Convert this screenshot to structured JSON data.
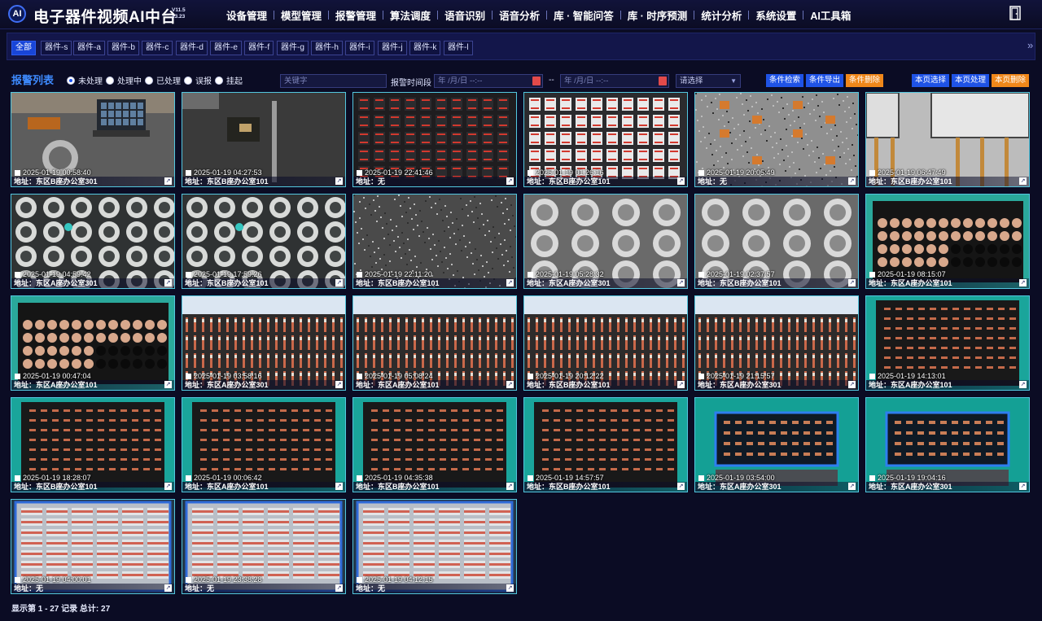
{
  "header": {
    "logo": "AI",
    "title": "电子器件视频AI中台",
    "version_top": "V11.5",
    "version_bottom": "x3.23",
    "nav": [
      "设备管理",
      "模型管理",
      "报警管理",
      "算法调度",
      "语音识别",
      "语音分析",
      "库 · 智能问答",
      "库 · 时序预测",
      "统计分析",
      "系统设置",
      "AI工具箱"
    ]
  },
  "filters": {
    "chips": [
      "全部",
      "器件-s",
      "器件-a",
      "器件-b",
      "器件-c",
      "器件-d",
      "器件-e",
      "器件-f",
      "器件-g",
      "器件-h",
      "器件-i",
      "器件-j",
      "器件-k",
      "器件-l"
    ],
    "active": "全部",
    "expand_icon": "chevron-double-right-icon"
  },
  "toolbar": {
    "title": "报警列表",
    "status_options": [
      "未处理",
      "处理中",
      "已处理",
      "误报",
      "挂起"
    ],
    "selected_status": "未处理",
    "keyword_placeholder": "关键字",
    "time_label": "报警时间段",
    "date_start_placeholder": "年 /月/日 --:--",
    "date_sep": "--",
    "date_end_placeholder": "年 /月/日 --:--",
    "select_placeholder": "请选择",
    "buttons_left": [
      "条件检索",
      "条件导出",
      "条件删除"
    ],
    "buttons_right": [
      "本页选择",
      "本页处理",
      "本页删除"
    ]
  },
  "alarms": [
    {
      "time": "2025-01-19 00:58:40",
      "addr": "地址：东区B座办公室301",
      "scene": "desk"
    },
    {
      "time": "2025-01-19 04:27:53",
      "addr": "地址：东区B座办公室101",
      "scene": "table"
    },
    {
      "time": "2025-01-19 22:41:46",
      "addr": "地址：无",
      "scene": "chips-dark"
    },
    {
      "time": "2025-01-19 01:26:16",
      "addr": "地址：东区B座办公室101",
      "scene": "chips-grid"
    },
    {
      "time": "2025-01-19 20:05:49",
      "addr": "地址：无",
      "scene": "granite"
    },
    {
      "time": "2025-01-19 06:47:49",
      "addr": "地址：东区B座办公室101",
      "scene": "component"
    },
    {
      "time": "2025-01-19 04:59:42",
      "addr": "地址：东区A座办公室301",
      "scene": "discs"
    },
    {
      "time": "2025-01-19 17:59:26",
      "addr": "地址：东区B座办公室101",
      "scene": "discs"
    },
    {
      "time": "2025-01-19 22:11:20",
      "addr": "地址：东区B座办公室101",
      "scene": "granite-dark"
    },
    {
      "time": "2025-01-19 05:28:32",
      "addr": "地址：东区A座办公室301",
      "scene": "discs-grey"
    },
    {
      "time": "2025-01-19 02:37:57",
      "addr": "地址：东区B座办公室101",
      "scene": "discs-grey"
    },
    {
      "time": "2025-01-19 08:15:07",
      "addr": "地址：东区A座办公室101",
      "scene": "pellets"
    },
    {
      "time": "2025-01-19 00:47:04",
      "addr": "地址：东区A座办公室101",
      "scene": "pellets"
    },
    {
      "time": "2025-01-19 03:58:16",
      "addr": "地址：东区A座办公室301",
      "scene": "resistors"
    },
    {
      "time": "2025-01-19 05:08:24",
      "addr": "地址：东区A座办公室101",
      "scene": "resistors"
    },
    {
      "time": "2025-01-19 20:12:22",
      "addr": "地址：东区B座办公室101",
      "scene": "resistors"
    },
    {
      "time": "2025-01-19 21:15:57",
      "addr": "地址：东区A座办公室301",
      "scene": "resistors"
    },
    {
      "time": "2025-01-19 14:13:01",
      "addr": "地址：东区A座办公室101",
      "scene": "tray"
    },
    {
      "time": "2025-01-19 18:28:07",
      "addr": "地址：东区B座办公室101",
      "scene": "tray"
    },
    {
      "time": "2025-01-19 00:06:42",
      "addr": "地址：东区A座办公室101",
      "scene": "tray"
    },
    {
      "time": "2025-01-19 04:35:38",
      "addr": "地址：东区B座办公室101",
      "scene": "tray"
    },
    {
      "time": "2025-01-19 14:57:57",
      "addr": "地址：东区B座办公室101",
      "scene": "tray"
    },
    {
      "time": "2025-01-19 03:54:00",
      "addr": "地址：东区A座办公室301",
      "scene": "tray-blue"
    },
    {
      "time": "2025-01-19 19:04:16",
      "addr": "地址：东区A座办公室301",
      "scene": "tray-blue"
    },
    {
      "time": "2025-01-19 04:00:01",
      "addr": "地址：无",
      "scene": "reels"
    },
    {
      "time": "2025-01-19 23:38:28",
      "addr": "地址：无",
      "scene": "reels"
    },
    {
      "time": "2025-01-19 04:12:15",
      "addr": "地址：无",
      "scene": "reels"
    }
  ],
  "footer": {
    "prefix": "显示第",
    "range": "1 - 27",
    "mid": "记录 总计:",
    "total": "27"
  },
  "colors": {
    "background": "#0b0c24",
    "accent_blue": "#1f53e6",
    "accent_orange": "#f0871a",
    "card_border": "#53c7df",
    "title_blue": "#3e8bff"
  }
}
